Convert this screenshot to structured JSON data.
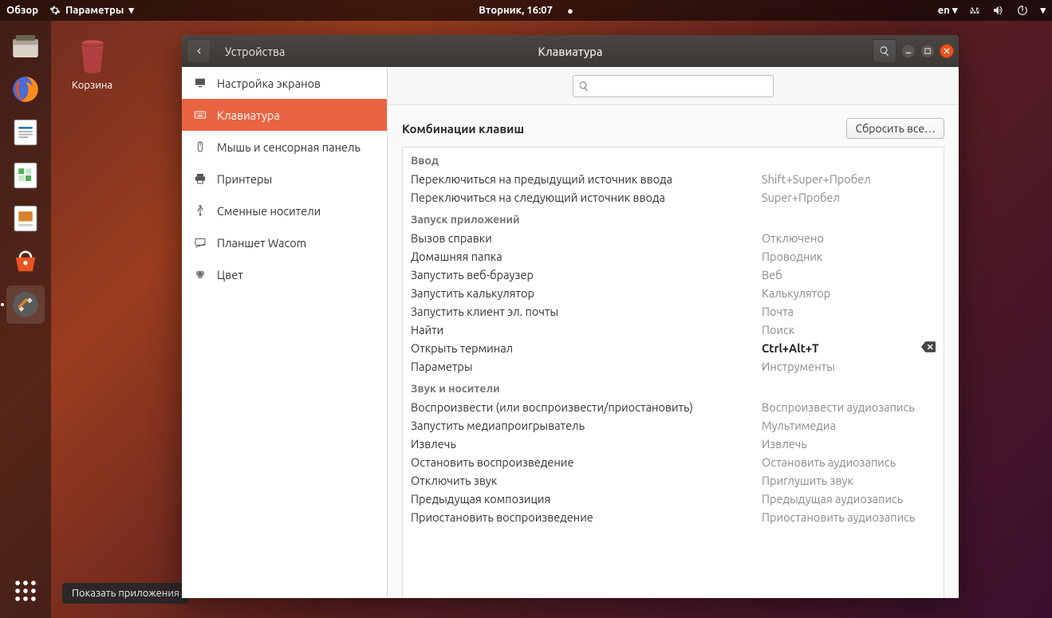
{
  "topbar": {
    "overview": "Обзор",
    "app_menu": "Параметры",
    "clock": "Вторник, 16:07",
    "lang": "en"
  },
  "desktop": {
    "trash_label": "Корзина"
  },
  "tooltip": "Показать приложения",
  "dock": {
    "items": [
      {
        "name": "files"
      },
      {
        "name": "firefox"
      },
      {
        "name": "writer"
      },
      {
        "name": "calc"
      },
      {
        "name": "impress"
      },
      {
        "name": "software"
      },
      {
        "name": "settings"
      }
    ]
  },
  "window": {
    "back_section": "Устройства",
    "title": "Клавиатура",
    "sidebar": [
      {
        "icon": "display",
        "label": "Настройка экранов"
      },
      {
        "icon": "keyboard",
        "label": "Клавиатура",
        "active": true
      },
      {
        "icon": "mouse",
        "label": "Мышь и сенсорная панель"
      },
      {
        "icon": "printer",
        "label": "Принтеры"
      },
      {
        "icon": "usb",
        "label": "Сменные носители"
      },
      {
        "icon": "tablet",
        "label": "Планшет Wacom"
      },
      {
        "icon": "color",
        "label": "Цвет"
      }
    ],
    "content": {
      "heading": "Комбинации клавиш",
      "reset": "Сбросить все…",
      "groups": [
        {
          "title": "Ввод",
          "rows": [
            {
              "label": "Переключиться на предыдущий источник ввода",
              "value": "Shift+Super+Пробел"
            },
            {
              "label": "Переключиться на следующий источник ввода",
              "value": "Super+Пробел"
            }
          ]
        },
        {
          "title": "Запуск приложений",
          "rows": [
            {
              "label": "Вызов справки",
              "value": "Отключено"
            },
            {
              "label": "Домашняя папка",
              "value": "Проводник"
            },
            {
              "label": "Запустить веб-браузер",
              "value": "Веб"
            },
            {
              "label": "Запустить калькулятор",
              "value": "Калькулятор"
            },
            {
              "label": "Запустить клиент эл. почты",
              "value": "Почта"
            },
            {
              "label": "Найти",
              "value": "Поиск"
            },
            {
              "label": "Открыть терминал",
              "value": "Ctrl+Alt+T",
              "active": true,
              "clear": true
            },
            {
              "label": "Параметры",
              "value": "Инструменты"
            }
          ]
        },
        {
          "title": "Звук и носители",
          "rows": [
            {
              "label": "Воспроизвести (или воспроизвести/приостановить)",
              "value": "Воспроизвести аудиозапись"
            },
            {
              "label": "Запустить медиапроигрыватель",
              "value": "Мультимедиа"
            },
            {
              "label": "Извлечь",
              "value": "Извлечь"
            },
            {
              "label": "Остановить воспроизведение",
              "value": "Остановить аудиозапись"
            },
            {
              "label": "Отключить звук",
              "value": "Приглушить звук"
            },
            {
              "label": "Предыдущая композиция",
              "value": "Предыдущая аудиозапись"
            },
            {
              "label": "Приостановить воспроизведение",
              "value": "Приостановить аудиозапись"
            }
          ]
        }
      ]
    }
  }
}
